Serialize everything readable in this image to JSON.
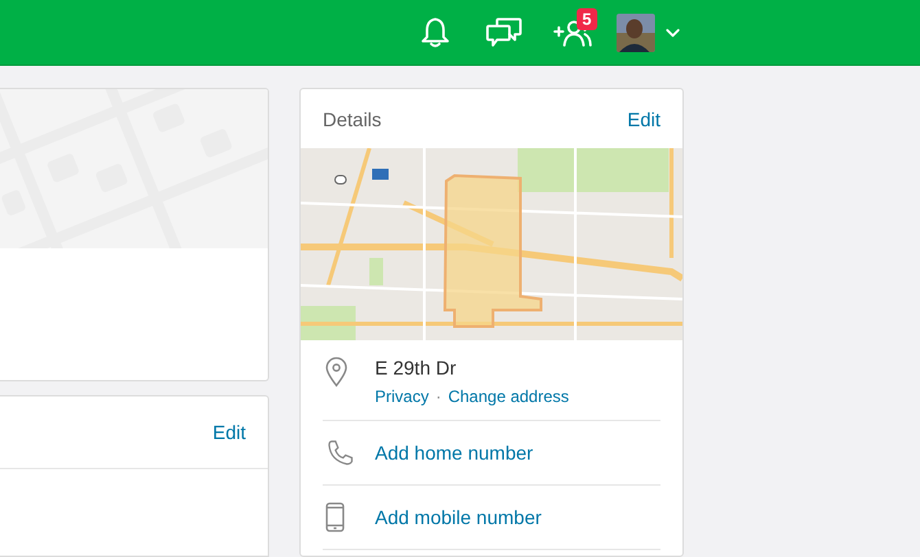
{
  "header": {
    "badge_count": "5"
  },
  "left_panel": {
    "edit_link": "Edit"
  },
  "details": {
    "title": "Details",
    "edit_link": "Edit",
    "address": "E 29th Dr",
    "address_links": [
      "Privacy",
      "Change address"
    ],
    "separator": "·",
    "contact_rows": [
      {
        "kind": "phone",
        "label": "Add home number"
      },
      {
        "kind": "mobile",
        "label": "Add mobile number"
      }
    ]
  }
}
